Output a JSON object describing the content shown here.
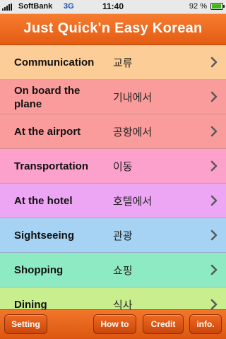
{
  "status_bar": {
    "carrier": "SoftBank",
    "network": "3G",
    "time": "11:40",
    "battery_percent": "92 %",
    "battery_level": 0.92
  },
  "header": {
    "title": "Just Quick'n Easy Korean"
  },
  "categories": [
    {
      "english": "Communication",
      "korean": "교류",
      "color": "#fccd96"
    },
    {
      "english": "On board the plane",
      "korean": "기내에서",
      "color": "#fb9c9c"
    },
    {
      "english": "At the airport",
      "korean": "공항에서",
      "color": "#fb9c9c"
    },
    {
      "english": "Transportation",
      "korean": "이동",
      "color": "#fca0cc"
    },
    {
      "english": "At the hotel",
      "korean": "호텔에서",
      "color": "#eca6f4"
    },
    {
      "english": "Sightseeing",
      "korean": "관광",
      "color": "#a6d3f3"
    },
    {
      "english": "Shopping",
      "korean": "쇼핑",
      "color": "#8deac2"
    },
    {
      "english": "Dining",
      "korean": "식사",
      "color": "#c8ee8e"
    }
  ],
  "toolbar": {
    "setting": "Setting",
    "how_to": "How to",
    "credit": "Credit",
    "info": "info."
  },
  "icons": {
    "row_chevron": "chevron-right-icon",
    "signal": "signal-bars-icon",
    "battery": "battery-icon"
  }
}
